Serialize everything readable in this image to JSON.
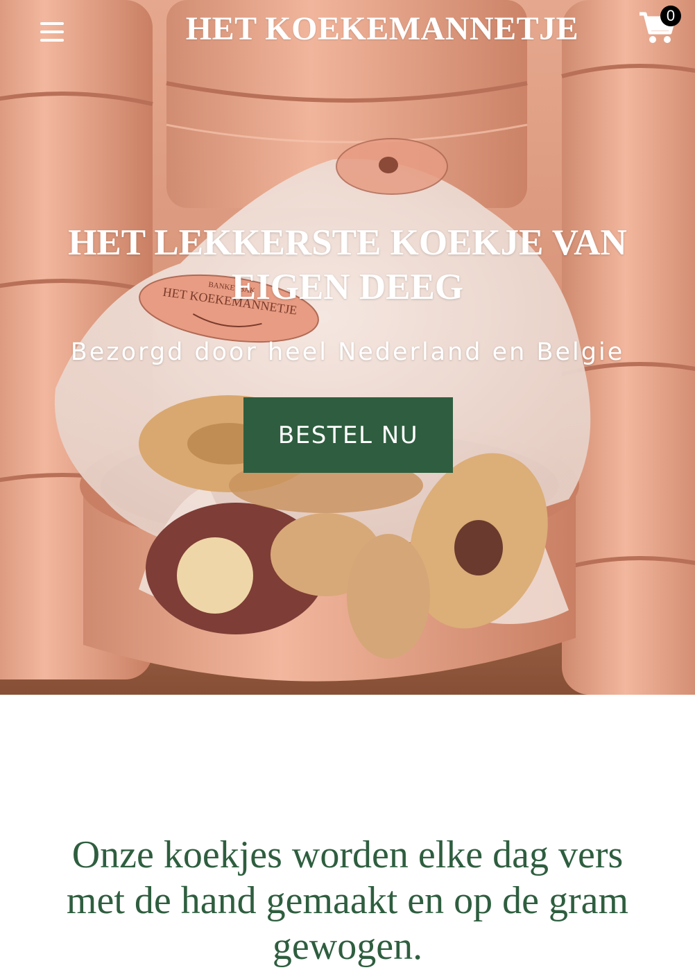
{
  "header": {
    "brand": "HET KOEKEMANNETJE",
    "cart_count": "0",
    "menu_icon": "hamburger-menu-icon",
    "cart_icon": "shopping-cart-icon",
    "text_color": "#ffffff"
  },
  "hero": {
    "title": "HET LEKKERSTE KOEKJE VAN EIGEN DEEG",
    "subtitle": "Bezorgd door heel Nederland en Belgie",
    "cta_label": "BESTEL NU",
    "cta_color": "#2e5e3f",
    "tin_label": "HET KOEKEMANNETJE",
    "tin_small_label": "BANKETBAK"
  },
  "intro": {
    "text": "Onze koekjes worden elke dag vers met de hand gemaakt en op de gram gewogen.",
    "color": "#2e5e3f"
  }
}
